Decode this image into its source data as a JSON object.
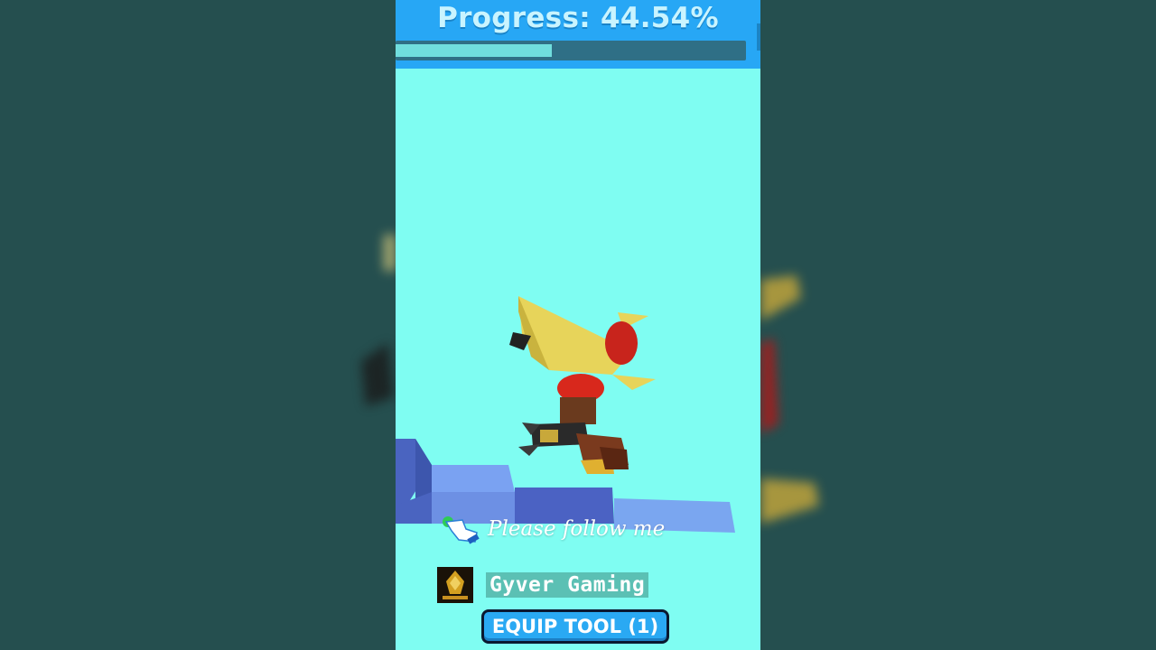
{
  "hud": {
    "progress_label": "Progress: 44.54%",
    "progress_fraction": 0.4454
  },
  "overlay": {
    "follow_text": "Please follow me",
    "channel_name": "Gyver Gaming",
    "channel_logo_icon": "gyver-gaming-logo-icon",
    "pointer_icon": "hand-pointer-icon"
  },
  "controls": {
    "equip_tool_label": "EQUIP TOOL (1)"
  },
  "colors": {
    "sky": "#7ffdf2",
    "hud_bar": "#27a7f5",
    "progress_fill": "#70dede",
    "button": "#2aa9f3",
    "backdrop": "#254f4f"
  }
}
